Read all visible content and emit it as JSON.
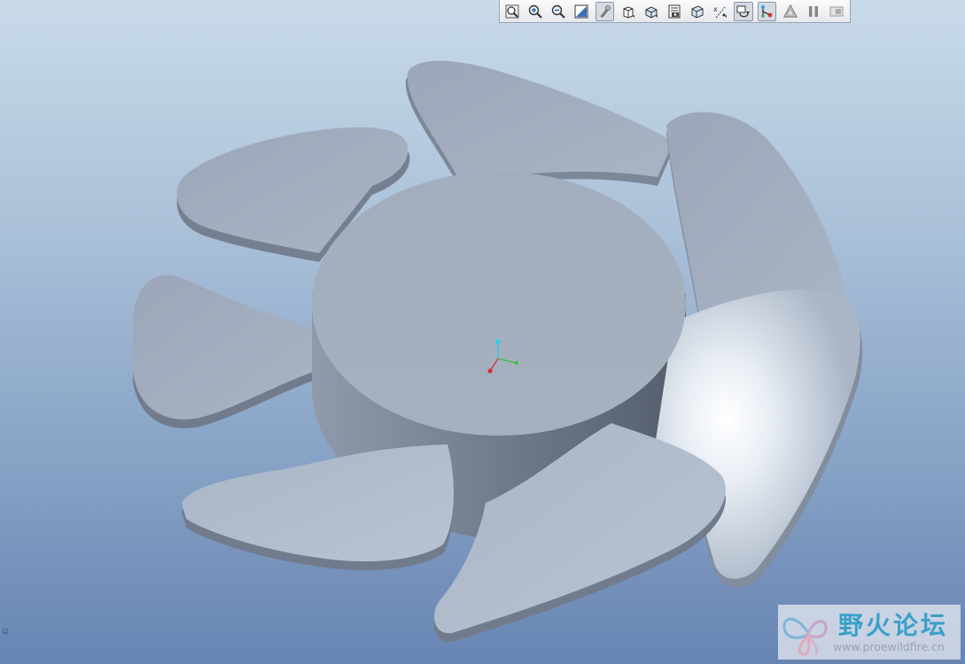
{
  "app": {
    "viewport_background": [
      "#c9dbe9",
      "#6884b3"
    ],
    "model_color": "#9eaabb"
  },
  "toolbar": {
    "buttons": [
      {
        "name": "refit",
        "icon": "zoom-fit-icon"
      },
      {
        "name": "zoom-in",
        "icon": "zoom-in-icon"
      },
      {
        "name": "zoom-out",
        "icon": "zoom-out-icon"
      },
      {
        "name": "repaint",
        "icon": "repaint-icon"
      },
      {
        "name": "shading",
        "icon": "shading-icon",
        "active": true
      },
      {
        "name": "saved-views",
        "icon": "view-cube-icon"
      },
      {
        "name": "named-views",
        "icon": "named-view-icon"
      },
      {
        "name": "view-manager",
        "icon": "view-manager-icon"
      },
      {
        "name": "perspective",
        "icon": "perspective-icon"
      },
      {
        "name": "datum-display",
        "icon": "datum-display-icon"
      },
      {
        "name": "spin-center",
        "icon": "spin-center-icon",
        "active": true
      },
      {
        "name": "annotation-display",
        "icon": "annotation-icon",
        "active": true
      },
      {
        "name": "mesh",
        "icon": "mesh-icon"
      },
      {
        "name": "pause",
        "icon": "pause-icon"
      },
      {
        "name": "flip",
        "icon": "flip-icon"
      }
    ]
  },
  "watermark": {
    "title": "野火论坛",
    "url": "www.proewildfire.cn",
    "logo_icon": "butterfly-logo-icon"
  },
  "corner_text": "以"
}
